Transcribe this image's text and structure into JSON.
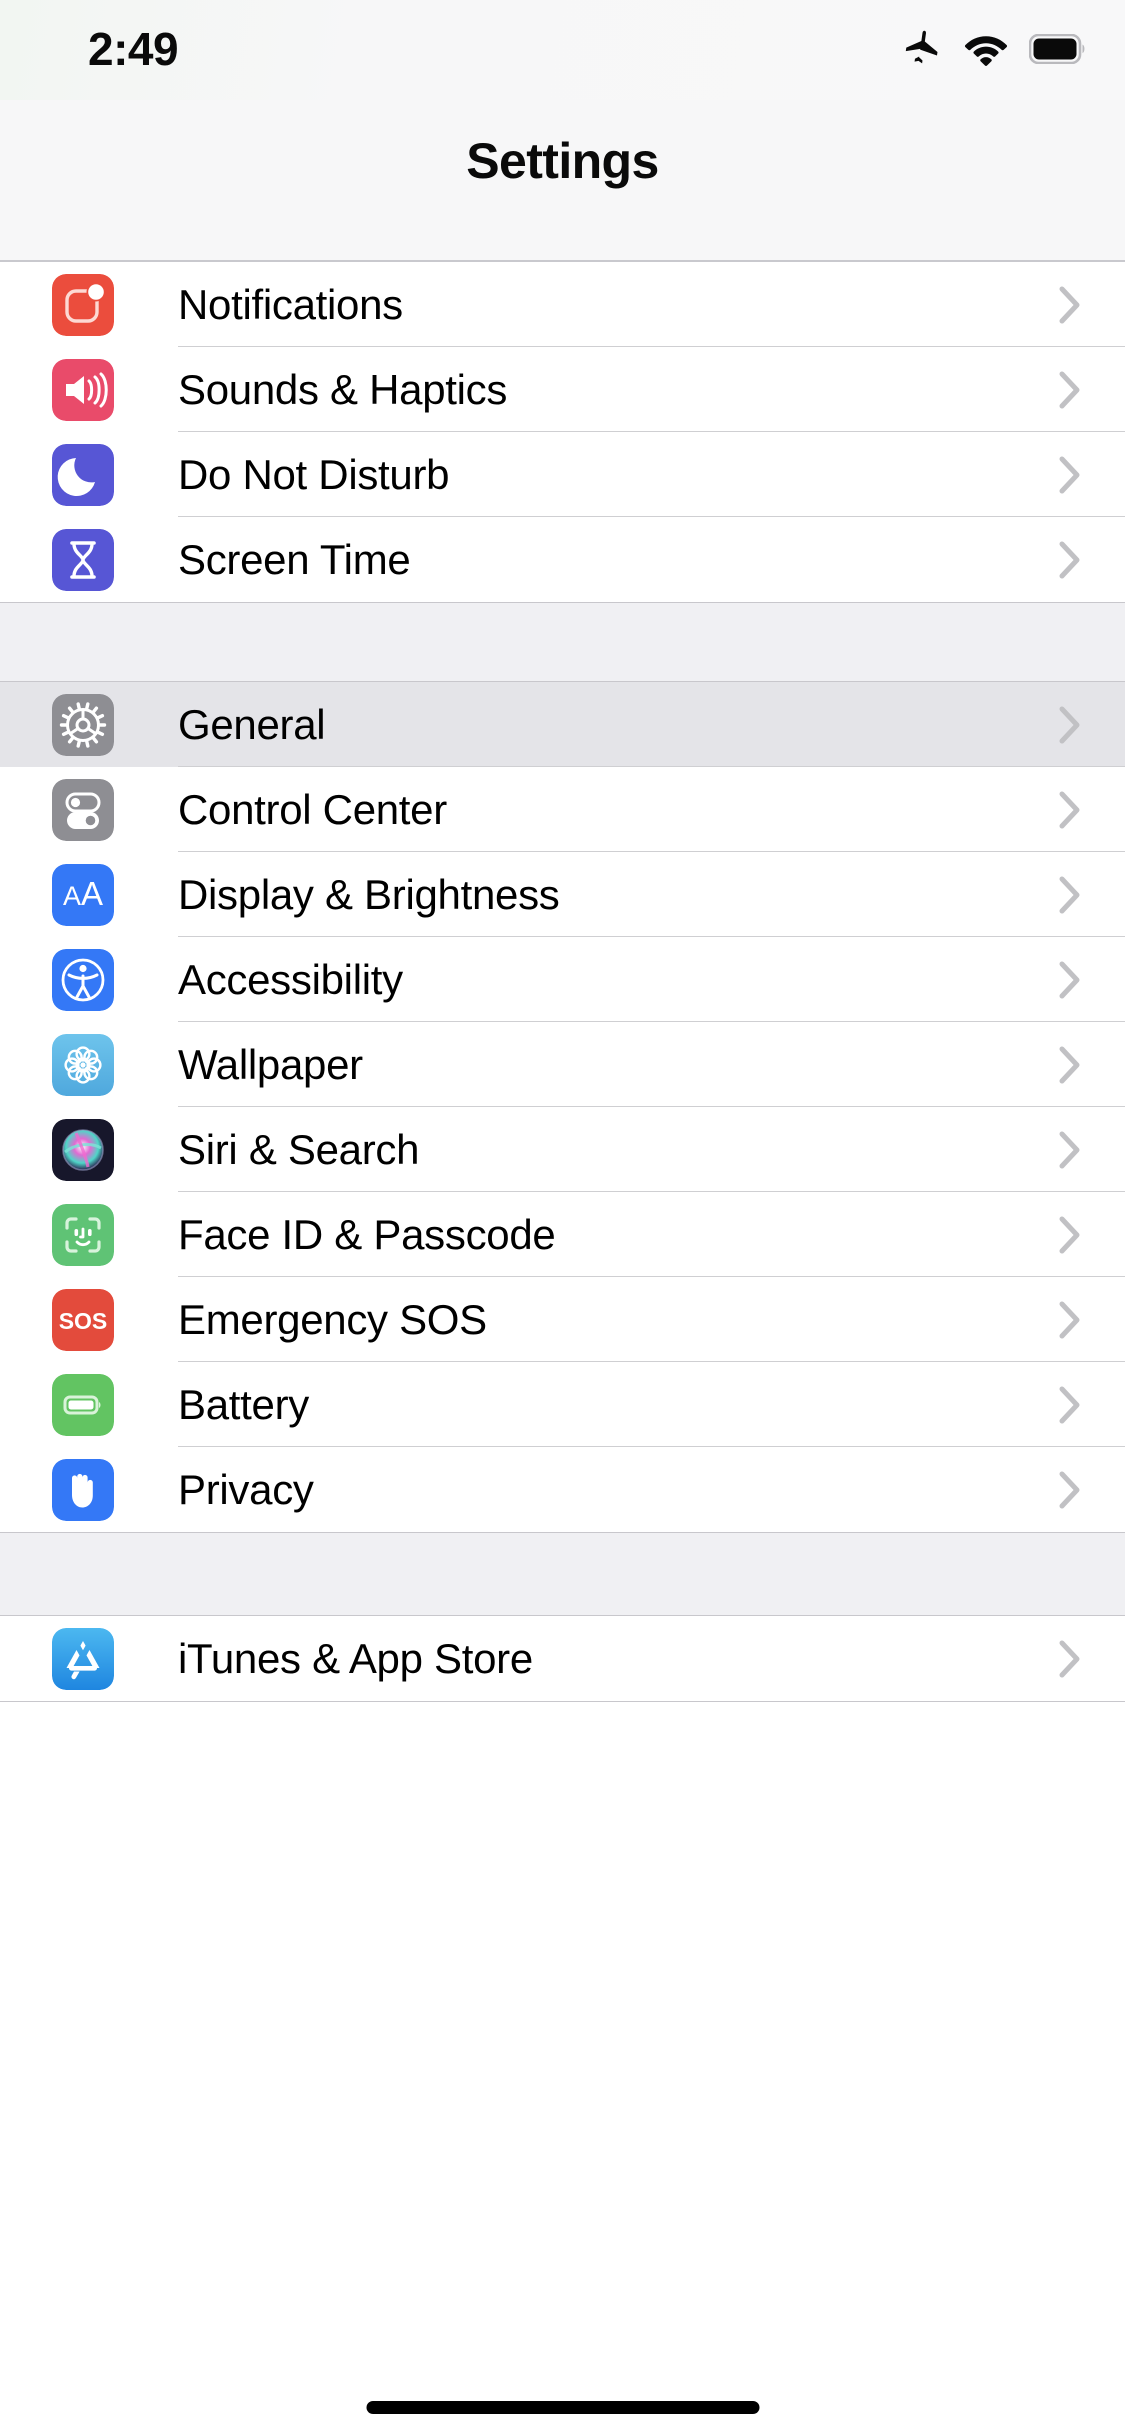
{
  "status_bar": {
    "time": "2:49",
    "icons": [
      {
        "name": "airplane-mode-icon",
        "label": "Airplane Mode"
      },
      {
        "name": "wifi-icon",
        "label": "Wi-Fi"
      },
      {
        "name": "battery-icon",
        "label": "Battery Full"
      }
    ]
  },
  "nav": {
    "title": "Settings"
  },
  "sections": [
    {
      "id": "alerts",
      "rows": [
        {
          "label": "Notifications",
          "icon": "notifications-icon",
          "icon_color": "#eb4d3d",
          "highlighted": false
        },
        {
          "label": "Sounds & Haptics",
          "icon": "sounds-haptics-icon",
          "icon_color": "#e94b6a",
          "highlighted": false
        },
        {
          "label": "Do Not Disturb",
          "icon": "do-not-disturb-icon",
          "icon_color": "#5756d5",
          "highlighted": false
        },
        {
          "label": "Screen Time",
          "icon": "screen-time-icon",
          "icon_color": "#5756d5",
          "highlighted": false
        }
      ]
    },
    {
      "id": "system",
      "rows": [
        {
          "label": "General",
          "icon": "general-gear-icon",
          "icon_color": "#8e8e93",
          "highlighted": true
        },
        {
          "label": "Control Center",
          "icon": "control-center-icon",
          "icon_color": "#8e8e93",
          "highlighted": false
        },
        {
          "label": "Display & Brightness",
          "icon": "display-brightness-icon",
          "icon_color": "#3478f6",
          "highlighted": false
        },
        {
          "label": "Accessibility",
          "icon": "accessibility-icon",
          "icon_color": "#3478f6",
          "highlighted": false
        },
        {
          "label": "Wallpaper",
          "icon": "wallpaper-icon",
          "icon_color": "#5bb4e5",
          "highlighted": false
        },
        {
          "label": "Siri & Search",
          "icon": "siri-search-icon",
          "icon_color": "#1c1c2e",
          "highlighted": false
        },
        {
          "label": "Face ID & Passcode",
          "icon": "face-id-icon",
          "icon_color": "#5fc375",
          "highlighted": false
        },
        {
          "label": "Emergency SOS",
          "icon": "emergency-sos-icon",
          "icon_color": "#e34b3c",
          "highlighted": false
        },
        {
          "label": "Battery",
          "icon": "battery-settings-icon",
          "icon_color": "#62c462",
          "highlighted": false
        },
        {
          "label": "Privacy",
          "icon": "privacy-hand-icon",
          "icon_color": "#3478f6",
          "highlighted": false
        }
      ]
    },
    {
      "id": "stores",
      "rows": [
        {
          "label": "iTunes & App Store",
          "icon": "app-store-icon",
          "icon_color": "#3aa8ec",
          "highlighted": false
        }
      ]
    }
  ],
  "colors": {
    "group_background": "#f0f0f3",
    "row_background": "#ffffff",
    "row_highlight": "#e4e4e8",
    "separator": "#c8c7cc",
    "chevron": "#c1c1c4",
    "label_text": "#000000"
  }
}
